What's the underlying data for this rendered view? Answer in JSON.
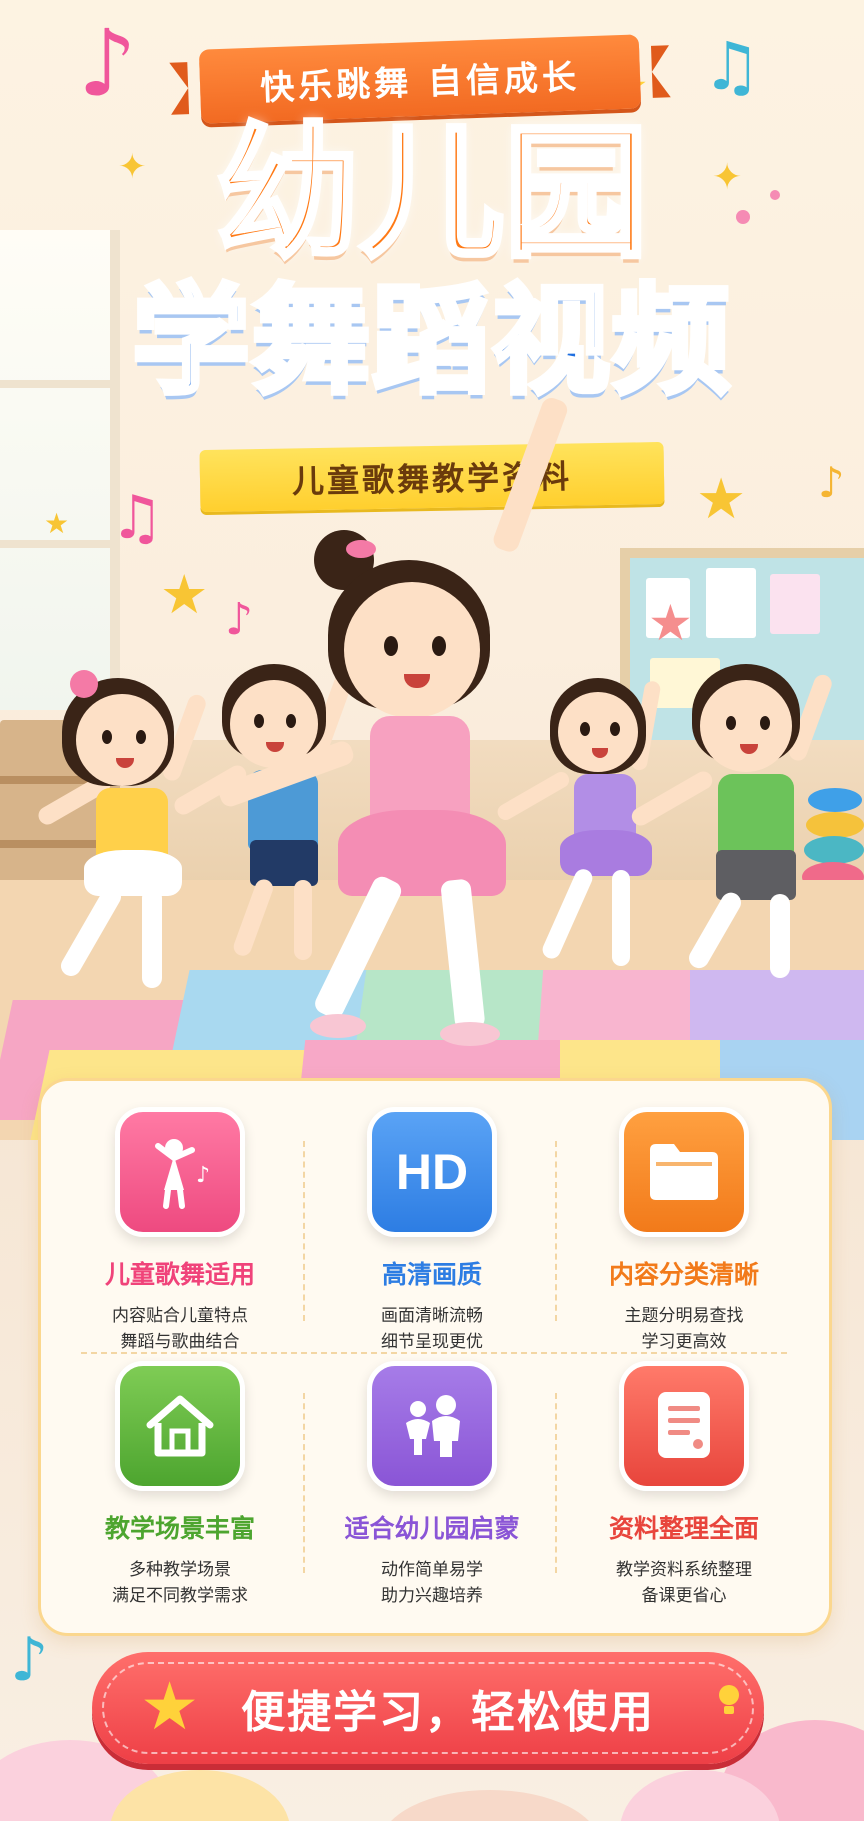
{
  "header": {
    "ribbon_text": "快乐跳舞  自信成长",
    "title_line1": "幼儿园",
    "title_line2": "学舞蹈视频",
    "subtitle": "儿童歌舞教学资料"
  },
  "features": [
    {
      "title": "儿童歌舞适用",
      "desc": "内容贴合儿童特点\n舞蹈与歌曲结合",
      "icon": "dancing-girl-icon",
      "color": "#f0437a"
    },
    {
      "title": "高清画质",
      "desc": "画面清晰流畅\n细节呈现更优",
      "icon": "hd-icon",
      "icon_text": "HD",
      "color": "#2d7de3"
    },
    {
      "title": "内容分类清晰",
      "desc": "主题分明易查找\n学习更高效",
      "icon": "folder-icon",
      "color": "#f27a1a"
    },
    {
      "title": "教学场景丰富",
      "desc": "多种教学场景\n满足不同教学需求",
      "icon": "house-icon",
      "color": "#4da52f"
    },
    {
      "title": "适合幼儿园启蒙",
      "desc": "动作简单易学\n助力兴趣培养",
      "icon": "children-icon",
      "color": "#8a55d6"
    },
    {
      "title": "资料整理全面",
      "desc": "教学资料系统整理\n备课更省心",
      "icon": "document-icon",
      "color": "#e8453c"
    }
  ],
  "cta": {
    "label": "便捷学习，轻松使用"
  },
  "colors": {
    "orange": "#ff7a16",
    "blue": "#1f6fe0",
    "yellow": "#ffd23a",
    "red": "#ee3f46"
  }
}
